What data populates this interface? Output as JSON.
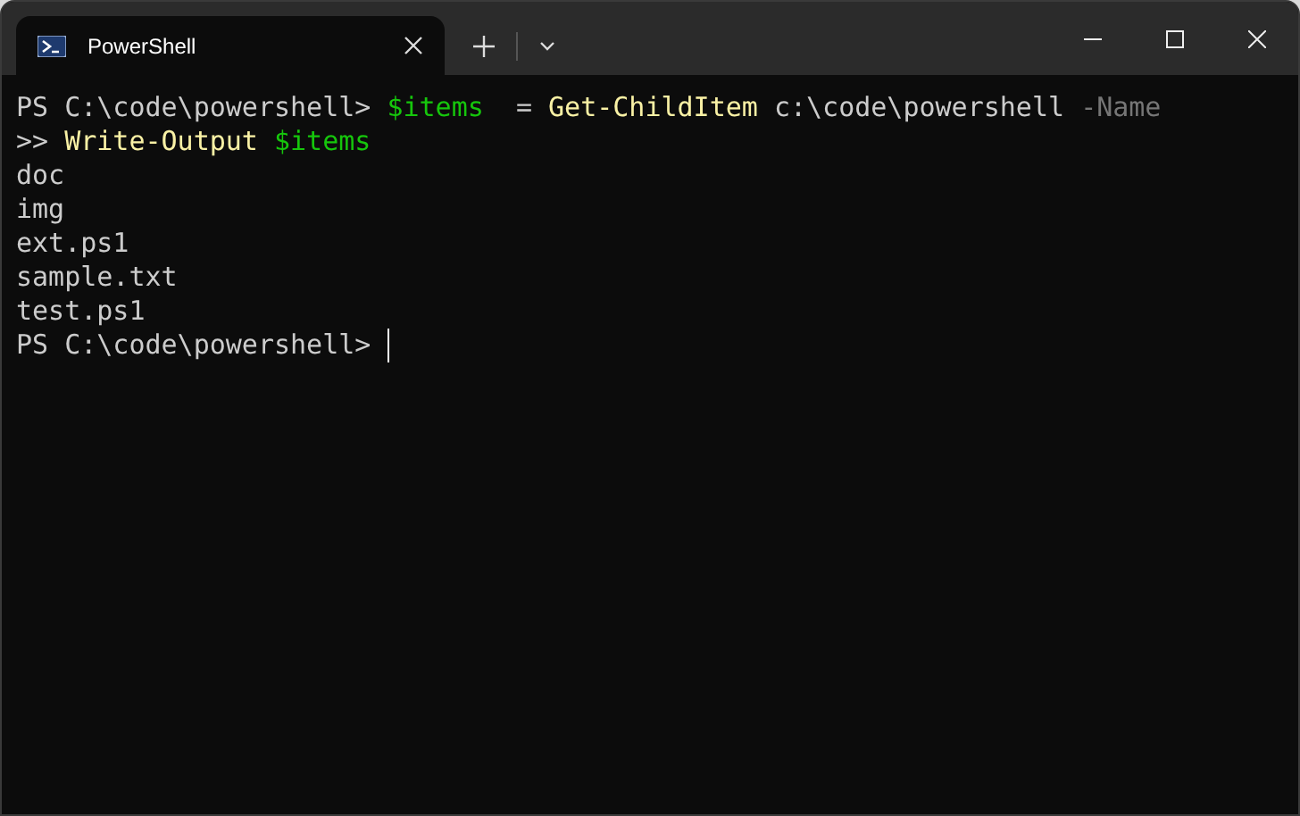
{
  "tab": {
    "title": "PowerShell",
    "selected": true
  },
  "lines": [
    [
      {
        "kind": "plain",
        "text": "PS C:\\code\\powershell> "
      },
      {
        "kind": "variable",
        "text": "$items"
      },
      {
        "kind": "plain",
        "text": "  = "
      },
      {
        "kind": "command",
        "text": "Get-ChildItem"
      },
      {
        "kind": "plain",
        "text": " c:\\code\\powershell "
      },
      {
        "kind": "parameter",
        "text": "-Name"
      }
    ],
    [
      {
        "kind": "plain",
        "text": ">> "
      },
      {
        "kind": "command",
        "text": "Write-Output"
      },
      {
        "kind": "variable",
        "text": " $items"
      }
    ],
    [
      {
        "kind": "plain",
        "text": "doc"
      }
    ],
    [
      {
        "kind": "plain",
        "text": "img"
      }
    ],
    [
      {
        "kind": "plain",
        "text": "ext.ps1"
      }
    ],
    [
      {
        "kind": "plain",
        "text": "sample.txt"
      }
    ],
    [
      {
        "kind": "plain",
        "text": "test.ps1"
      }
    ],
    [
      {
        "kind": "plain",
        "text": "PS C:\\code\\powershell> "
      }
    ]
  ],
  "cursor": true
}
